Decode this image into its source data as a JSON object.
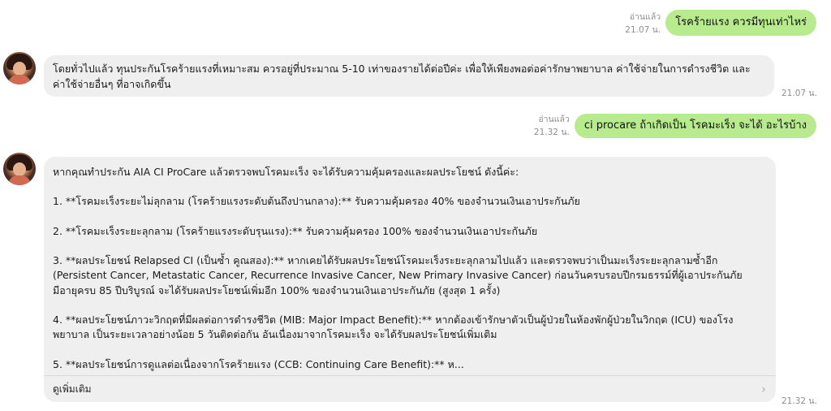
{
  "messages": [
    {
      "read": "อ่านแล้ว",
      "time": "21.07 น.",
      "text": "โรคร้ายแรง ควรมีทุนเท่าไหร่"
    },
    {
      "text": "โดยทั่วไปแล้ว ทุนประกันโรคร้ายแรงที่เหมาะสม ควรอยู่ที่ประมาณ 5-10 เท่าของรายได้ต่อปีค่ะ เพื่อให้เพียงพอต่อค่ารักษาพยาบาล ค่าใช้จ่ายในการดำรงชีวิต และค่าใช้จ่ายอื่นๆ ที่อาจเกิดขึ้น",
      "time": "21.07 น."
    },
    {
      "read": "อ่านแล้ว",
      "time": "21.32 น.",
      "text": "ci procare ถ้าเกิดเป็น โรคมะเร็ง จะได้ อะไรบ้าง"
    },
    {
      "paragraphs": [
        "หากคุณทำประกัน AIA CI ProCare แล้วตรวจพบโรคมะเร็ง จะได้รับความคุ้มครองและผลประโยชน์ ดังนี้ค่ะ:",
        "1.  **โรคมะเร็งระยะไม่ลุกลาม (โรคร้ายแรงระดับต้นถึงปานกลาง):** รับความคุ้มครอง 40% ของจำนวนเงินเอาประกันภัย",
        "2.  **โรคมะเร็งระยะลุกลาม (โรคร้ายแรงระดับรุนแรง):** รับความคุ้มครอง 100% ของจำนวนเงินเอาประกันภัย",
        "3.  **ผลประโยชน์ Relapsed CI (เป็นซ้ำ คูณสอง):** หากเคยได้รับผลประโยชน์โรคมะเร็งระยะลุกลามไปแล้ว และตรวจพบว่าเป็นมะเร็งระยะลุกลามซ้ำอีก (Persistent Cancer, Metastatic Cancer, Recurrence Invasive Cancer, New Primary Invasive Cancer) ก่อนวันครบรอบปีกรมธรรม์ที่ผู้เอาประกันภัยมีอายุครบ 85 ปีบริบูรณ์ จะได้รับผลประโยชน์เพิ่มอีก 100% ของจำนวนเงินเอาประกันภัย (สูงสุด 1 ครั้ง)",
        "4.  **ผลประโยชน์ภาวะวิกฤตที่มีผลต่อการดำรงชีวิต (MIB: Major Impact Benefit):** หากต้องเข้ารักษาตัวเป็นผู้ป่วยในห้องพักผู้ป่วยในวิกฤต (ICU) ของโรงพยาบาล เป็นระยะเวลาอย่างน้อย 5 วันติดต่อกัน อันเนื่องมาจากโรคมะเร็ง จะได้รับผลประโยชน์เพิ่มเติม",
        "5.  **ผลประโยชน์การดูแลต่อเนื่องจากโรคร้ายแรง (CCB: Continuing Care Benefit):** ห..."
      ],
      "see_more": "ดูเพิ่มเติม",
      "time": "21.32 น."
    }
  ]
}
